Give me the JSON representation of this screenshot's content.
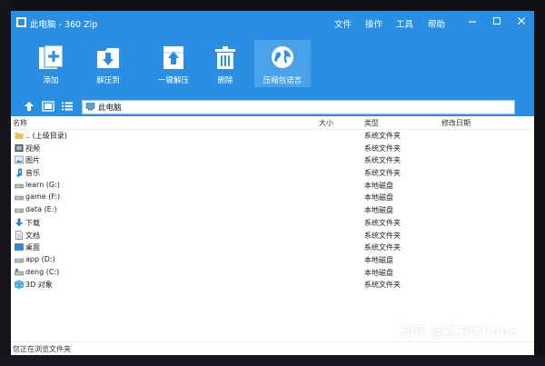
{
  "window": {
    "title": "此电脑 - 360 Zip",
    "menu": [
      "文件",
      "操作",
      "工具",
      "帮助"
    ]
  },
  "toolbar": {
    "items": [
      {
        "label": "添加",
        "icon": "add-icon"
      },
      {
        "label": "解压到",
        "icon": "extract-to-icon"
      },
      {
        "label": "一键解压",
        "icon": "one-click-extract-icon"
      },
      {
        "label": "删除",
        "icon": "delete-icon"
      },
      {
        "label": "压缩包语言",
        "icon": "globe-icon"
      }
    ]
  },
  "address": {
    "path": "此电脑"
  },
  "columns": {
    "name": "名称",
    "size": "大小",
    "type": "类型",
    "modified": "修改日期"
  },
  "files": [
    {
      "name": ".. (上级目录)",
      "type": "系统文件夹",
      "icon": "folder-up-icon"
    },
    {
      "name": "视频",
      "type": "系统文件夹",
      "icon": "video-icon"
    },
    {
      "name": "图片",
      "type": "系统文件夹",
      "icon": "picture-icon"
    },
    {
      "name": "音乐",
      "type": "系统文件夹",
      "icon": "music-icon"
    },
    {
      "name": "learn (G:)",
      "type": "本地磁盘",
      "icon": "drive-icon"
    },
    {
      "name": "game (F:)",
      "type": "本地磁盘",
      "icon": "drive-icon"
    },
    {
      "name": "data (E:)",
      "type": "本地磁盘",
      "icon": "drive-icon"
    },
    {
      "name": "下载",
      "type": "系统文件夹",
      "icon": "download-icon"
    },
    {
      "name": "文档",
      "type": "系统文件夹",
      "icon": "document-icon"
    },
    {
      "name": "桌面",
      "type": "系统文件夹",
      "icon": "desktop-icon"
    },
    {
      "name": "app (D:)",
      "type": "本地磁盘",
      "icon": "drive-icon"
    },
    {
      "name": "deng (C:)",
      "type": "本地磁盘",
      "icon": "system-drive-icon"
    },
    {
      "name": "3D 对象",
      "type": "系统文件夹",
      "icon": "3d-objects-icon"
    }
  ],
  "status": {
    "text": "您正在浏览文件夹"
  },
  "watermark": {
    "text": "知乎 @立方体Cube"
  },
  "colors": {
    "accent": "#2a8fe3",
    "active_tool": "#4aa2ea"
  }
}
